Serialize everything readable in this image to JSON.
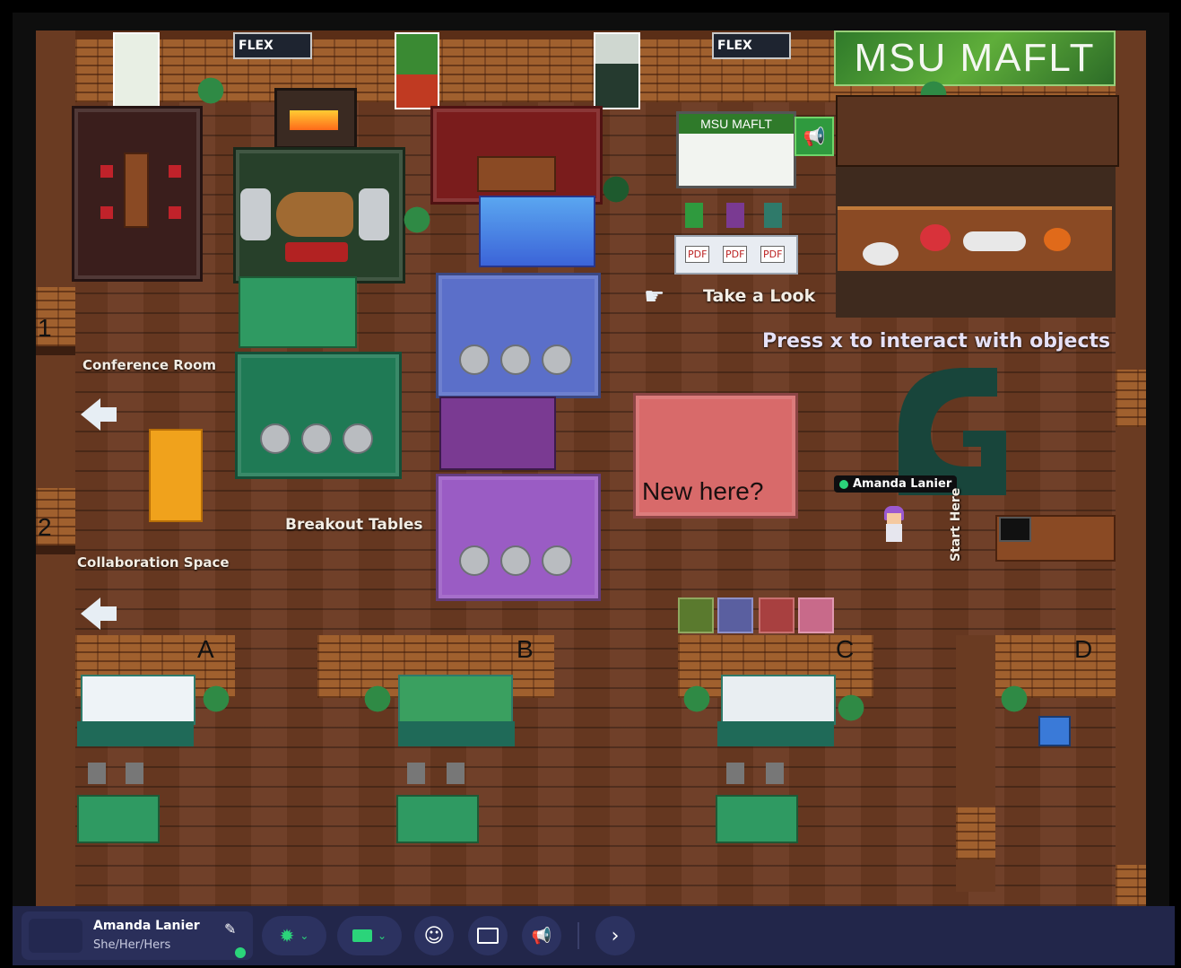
{
  "world": {
    "logo_text": "MSU MAFLT",
    "kiosk_logo_text": "MSU MAFLT",
    "poster_texts": [
      "FLEX",
      "FLEX"
    ],
    "labels": {
      "take_a_look": "Take a Look",
      "press_x": "Press x to interact with objects",
      "conference_room": "Conference Room",
      "breakout_tables": "Breakout Tables",
      "collaboration_space": "Collaboration Space",
      "new_here": "New here?",
      "start_here": "Start Here"
    },
    "room_numbers": [
      "1",
      "2"
    ],
    "room_letters": [
      "A",
      "B",
      "C",
      "D"
    ],
    "pdf_labels": [
      "PDF",
      "PDF",
      "PDF"
    ],
    "player": {
      "name": "Amanda Lanier"
    },
    "colors": {
      "spartan_green": "#18453b",
      "floor": "#6b3a22",
      "brick": "#a0602e"
    }
  },
  "toolbar": {
    "user_name": "Amanda Lanier",
    "pronouns": "She/Her/Hers",
    "icons": [
      "edit-icon",
      "status-icon",
      "camera-icon",
      "emoji-icon",
      "screen-share-icon",
      "megaphone-icon",
      "chevron-right-icon"
    ]
  }
}
